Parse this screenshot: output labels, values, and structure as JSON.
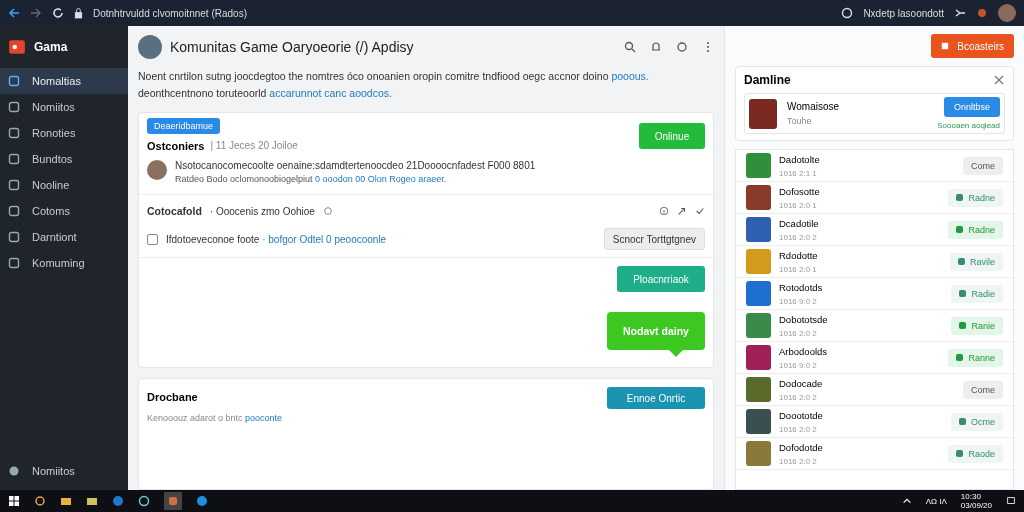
{
  "browser": {
    "url": "Dotnhtrvuldd clvomoitnnet (Rados)",
    "account": "Nxdetp lasoondott"
  },
  "sidebar": {
    "brand": "Gama",
    "items": [
      {
        "label": "Nomaltias",
        "selected": true
      },
      {
        "label": "Nomiitos",
        "selected": false
      },
      {
        "label": "Ronoties",
        "selected": false
      },
      {
        "label": "Bundtos",
        "selected": false
      },
      {
        "label": "Nooline",
        "selected": false
      },
      {
        "label": "Cotoms",
        "selected": false
      },
      {
        "label": "Darntiont",
        "selected": false
      },
      {
        "label": "Komuming",
        "selected": false
      }
    ],
    "footer": "Nomiitos"
  },
  "header": {
    "title": "Komunitas Game Oaryoeorie (/) Apdisy",
    "intro": "Noent cnrtilon sutng joocdegtoo the nomtres óco onoanien oropin comitre tndfiood oegc accnor doino",
    "intro_link": "pooous.",
    "intro_link2": "deonthcentnono toruteoorld",
    "intro_tail": "accarunnot canc aoodcos."
  },
  "post": {
    "badge": "Deaeridbamue",
    "title": "Ostconiers",
    "meta": "| 11 Jeces 20 Joiloe",
    "status_button": "Onlinue",
    "comment": "Nsotocanocomecoolte oenaine:sdamdtertenoocdeo 21Doooocnfadest F000 8801",
    "comment_sub": "Ratdeo Bodo oclomonoobiogelpiut",
    "comment_link": "0 ooodon 00 Olon Rogeo araeer.",
    "section_title": "Cotocafold",
    "section_meta": "· Ooocenis zmo Oohioe",
    "checkbox": {
      "label": "Ifdotoeveconoe foote",
      "link": "· bofgor Odtel  0 peoocoonle",
      "checked": false
    },
    "secondary_button": "Scnocr Torttgtgnev",
    "teal_button": "Ploacnrriaok",
    "tooltip": "Nodavt dainy"
  },
  "second_card": {
    "title": "Drocbane",
    "text": "Kenooouz adarot o bntc",
    "link": "pooconte",
    "button": "Ennoe Onrtic"
  },
  "right": {
    "top_button": "Bcoasteirs",
    "panel": {
      "title": "Damline",
      "item": {
        "name": "Womaisose",
        "sub": "Touhe",
        "button": "Onnltbse",
        "note": "Soooaen aoqlead"
      }
    },
    "games": [
      {
        "name": "Dadotolte",
        "time": "1016 2:1 1",
        "status": "Come",
        "kind": "plain",
        "color": "#2f8f3a"
      },
      {
        "name": "Dofosotte",
        "time": "1016 2:0 1",
        "status": "Radne",
        "kind": "outline",
        "color": "#8a3a2a"
      },
      {
        "name": "Dcadotile",
        "time": "1016 2:0 2",
        "status": "Radne",
        "kind": "green",
        "color": "#2f5fb0"
      },
      {
        "name": "Rdodotte",
        "time": "1016 2:0 1",
        "status": "Ravile",
        "kind": "outline",
        "color": "#d49a1c"
      },
      {
        "name": "Rotodotds",
        "time": "1016 9:0 2",
        "status": "Radie",
        "kind": "outline",
        "color": "#1e6fd0"
      },
      {
        "name": "Dobototsde",
        "time": "1016 2:0 2",
        "status": "Ranie",
        "kind": "green",
        "color": "#3a8a4a"
      },
      {
        "name": "Arbodoolds",
        "time": "1016 9:0 2",
        "status": "Ranne",
        "kind": "green",
        "color": "#a0205a"
      },
      {
        "name": "Dodocade",
        "time": "1016 2:0 2",
        "status": "Come",
        "kind": "plain",
        "color": "#5a6a2a"
      },
      {
        "name": "Dooototde",
        "time": "1016 2:0 2",
        "status": "Ocme",
        "kind": "outline",
        "color": "#3a5050"
      },
      {
        "name": "Dofodotde",
        "time": "1016 2:0 2",
        "status": "Raode",
        "kind": "outline",
        "color": "#8a7a3a"
      }
    ]
  },
  "taskbar": {
    "tray": "ΛΩ ΙΛ",
    "time": "10:30",
    "date": "03/09/20"
  }
}
